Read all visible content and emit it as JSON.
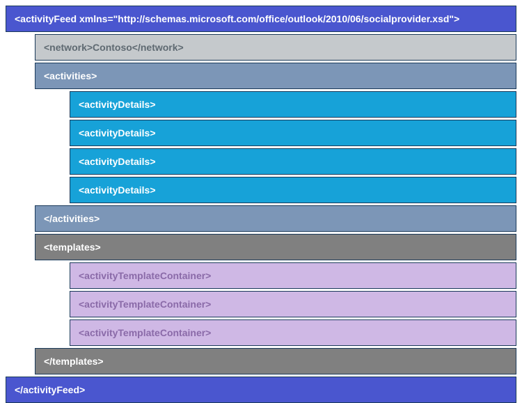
{
  "root_open": "<activityFeed xmlns=\"http://schemas.microsoft.com/office/outlook/2010/06/socialprovider.xsd\">",
  "network": "<network>Contoso</network>",
  "activities_open": "<activities>",
  "activity_details": [
    "<activityDetails>",
    "<activityDetails>",
    "<activityDetails>",
    "<activityDetails>"
  ],
  "activities_close": "</activities>",
  "templates_open": "<templates>",
  "template_containers": [
    "<activityTemplateContainer>",
    "<activityTemplateContainer>",
    "<activityTemplateContainer>"
  ],
  "templates_close": "</templates>",
  "root_close": "</activityFeed>"
}
